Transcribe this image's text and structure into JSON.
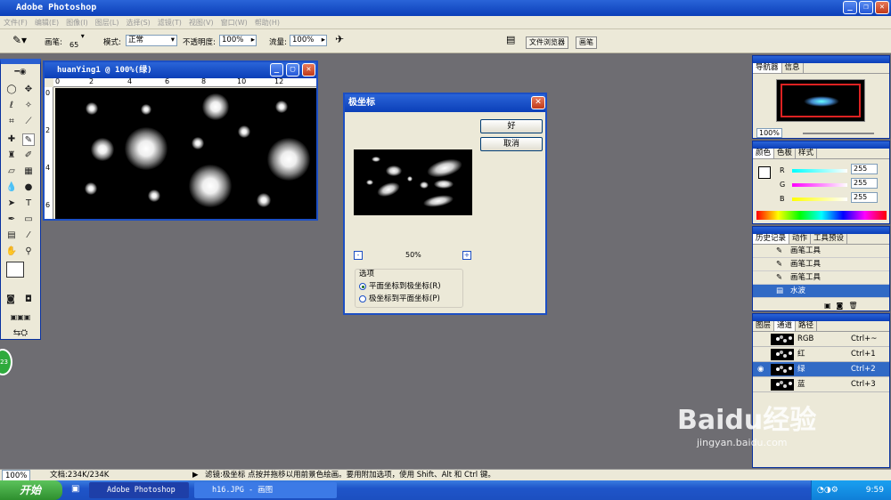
{
  "app": {
    "title": "Adobe Photoshop"
  },
  "menu": [
    "文件(F)",
    "编辑(E)",
    "图像(I)",
    "图层(L)",
    "选择(S)",
    "滤镜(T)",
    "视图(V)",
    "窗口(W)",
    "帮助(H)"
  ],
  "options": {
    "brush_label": "画笔:",
    "brush_size": "65",
    "mode_label": "模式:",
    "mode_value": "正常",
    "opacity_label": "不透明度:",
    "opacity_value": "100%",
    "flow_label": "流量:",
    "flow_value": "100%",
    "dock_tabs": [
      "文件浏览器",
      "画笔"
    ]
  },
  "document": {
    "title": "huanYing1 @ 100%(绿)",
    "ruler_marks": [
      "0",
      "2",
      "4",
      "6",
      "8",
      "10",
      "12"
    ],
    "vruler_marks": [
      "0",
      "2",
      "4",
      "6"
    ]
  },
  "dialog": {
    "title": "极坐标",
    "ok": "好",
    "cancel": "取消",
    "zoom": "50%",
    "zoom_out": "-",
    "zoom_in": "+",
    "options_legend": "选项",
    "option1": "平面坐标到极坐标(R)",
    "option2": "极坐标到平面坐标(P)"
  },
  "navigator": {
    "tabs": [
      "导航器",
      "信息"
    ],
    "zoom": "100%"
  },
  "color": {
    "tabs": [
      "颜色",
      "色板",
      "样式"
    ],
    "r_label": "R",
    "g_label": "G",
    "b_label": "B",
    "r": "255",
    "g": "255",
    "b": "255"
  },
  "history": {
    "tabs": [
      "历史记录",
      "动作",
      "工具预设"
    ],
    "items": [
      "画笔工具",
      "画笔工具",
      "画笔工具",
      "水波"
    ]
  },
  "channels": {
    "tabs": [
      "图层",
      "通道",
      "路径"
    ],
    "rows": [
      {
        "name": "RGB",
        "shortcut": "Ctrl+~"
      },
      {
        "name": "红",
        "shortcut": "Ctrl+1"
      },
      {
        "name": "绿",
        "shortcut": "Ctrl+2"
      },
      {
        "name": "蓝",
        "shortcut": "Ctrl+3"
      }
    ]
  },
  "status": {
    "zoom": "100%",
    "doc": "文档:234K/234K",
    "hint": "滤镜:极坐标   点按并拖移以用前景色绘画。要用附加选项，使用 Shift、Alt 和 Ctrl 键。"
  },
  "taskbar": {
    "start": "开始",
    "tasks": [
      "Adobe Photoshop",
      "h16.JPG - 画图"
    ],
    "time": "9:59"
  },
  "badge": "23",
  "watermark": {
    "brand": "Baidu经验",
    "url": "jingyan.baidu.com"
  }
}
